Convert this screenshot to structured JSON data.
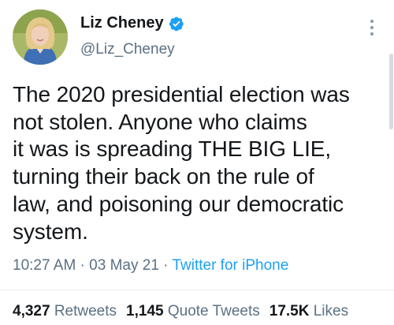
{
  "author": {
    "name": "Liz Cheney",
    "handle": "@Liz_Cheney",
    "verified": true,
    "avatar": "profile-photo"
  },
  "tweet": {
    "text": "The 2020 presidential election was\nnot stolen. Anyone who claims\nit was is spreading THE BIG LIE,\nturning their back on the rule of\nlaw, and poisoning our democratic\nsystem."
  },
  "meta": {
    "time": "10:27 AM",
    "separator": " · ",
    "date": "03 May 21",
    "source": "Twitter for iPhone"
  },
  "stats": {
    "retweets_count": "4,327",
    "retweets_label": "Retweets",
    "quote_tweets_count": "1,145",
    "quote_tweets_label": "Quote Tweets",
    "likes_count": "17.5K",
    "likes_label": "Likes"
  },
  "icons": {
    "verified": "verified-badge-icon",
    "more": "more-vertical-icon"
  },
  "colors": {
    "text": "#14171a",
    "secondary": "#5b7083",
    "link": "#1da1f2",
    "verified": "#1da1f2"
  }
}
